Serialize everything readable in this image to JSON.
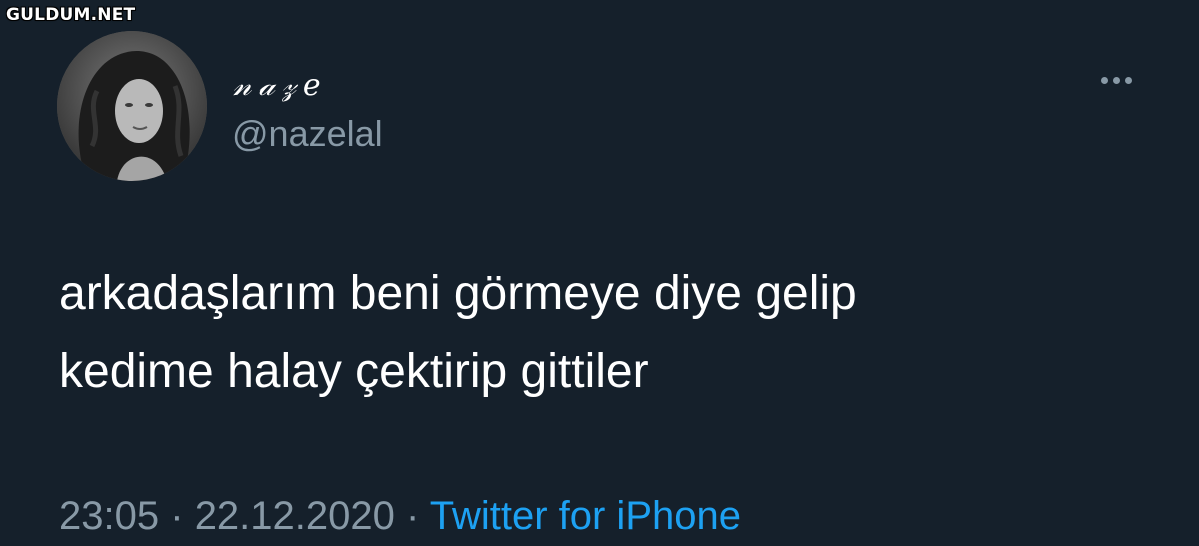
{
  "watermark": "GULDUM.NET",
  "user": {
    "display_name": "𝓃𝒶𝓏𝑒",
    "handle": "@nazelal",
    "avatar_icon": "profile-photo"
  },
  "more_icon": "ellipsis-icon",
  "tweet": {
    "lines": [
      "arkadaşlarım beni görmeye diye gelip",
      "kedime halay çektirip gittiler"
    ],
    "time": "23:05",
    "separator": "·",
    "date": "22.12.2020",
    "source": "Twitter for iPhone"
  },
  "colors": {
    "background": "#15202b",
    "text": "#ffffff",
    "secondary_text": "#8899a6",
    "accent": "#1da1f2"
  }
}
